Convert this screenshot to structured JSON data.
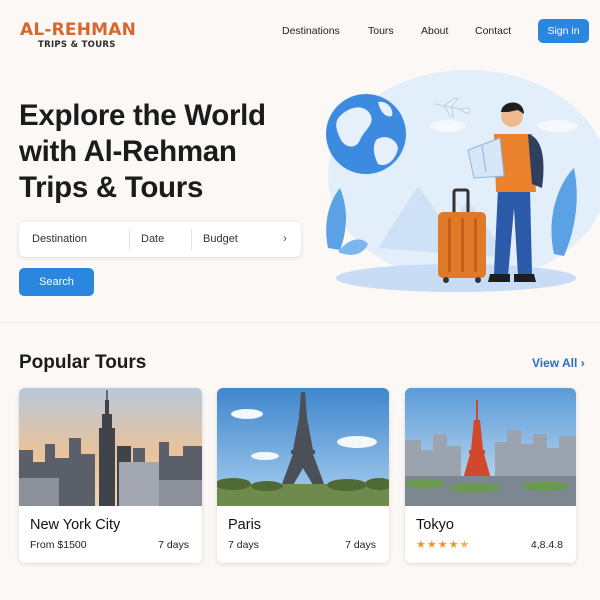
{
  "brand": {
    "name": "AL-REHMAN",
    "tagline": "TRIPS & TOURS"
  },
  "nav": {
    "items": [
      "Destinations",
      "Tours",
      "About",
      "Contact"
    ],
    "signin_label": "Sign in"
  },
  "hero": {
    "title_lines": [
      "Explore the World",
      "with Al-Rehman",
      "Trips & Tours"
    ]
  },
  "search": {
    "fields": [
      "Destination",
      "Date",
      "Budget"
    ],
    "button_label": "Search"
  },
  "popular": {
    "title": "Popular Tours",
    "view_all": "View All",
    "tours": [
      {
        "name": "New York City",
        "price": "From $1500",
        "duration": "7 days"
      },
      {
        "name": "Paris",
        "price": "7 days",
        "duration": "7 days"
      },
      {
        "name": "Tokyo",
        "rating_stars": 4.5,
        "rating_text": "4,8.4.8"
      }
    ]
  },
  "colors": {
    "brand_orange": "#d9662a",
    "accent_blue": "#2b86e0",
    "link_blue": "#2b6fc4",
    "star": "#e99a1e"
  }
}
